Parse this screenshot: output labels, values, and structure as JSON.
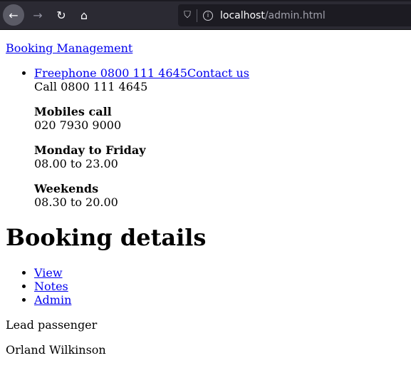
{
  "browser": {
    "url_host": "localhost",
    "url_path": "/admin.html",
    "icons": [
      "back-arrow-icon",
      "forward-arrow-icon",
      "reload-icon",
      "home-icon",
      "shield-icon",
      "info-icon"
    ]
  },
  "header": {
    "brand_link": "Booking Management"
  },
  "contact": {
    "freephone_link": "Freephone 0800 111 4645",
    "contact_link": "Contact us",
    "call_text": "Call 0800 111 4645",
    "blocks": [
      {
        "title": "Mobiles call",
        "value": "020 7930 9000"
      },
      {
        "title": "Monday to Friday",
        "value": "08.00 to 23.00"
      },
      {
        "title": "Weekends",
        "value": "08.30 to 20.00"
      }
    ]
  },
  "main": {
    "title": "Booking details",
    "nav": [
      "View",
      "Notes",
      "Admin"
    ],
    "lead_label": "Lead passenger",
    "lead_name": "Orland Wilkinson"
  }
}
